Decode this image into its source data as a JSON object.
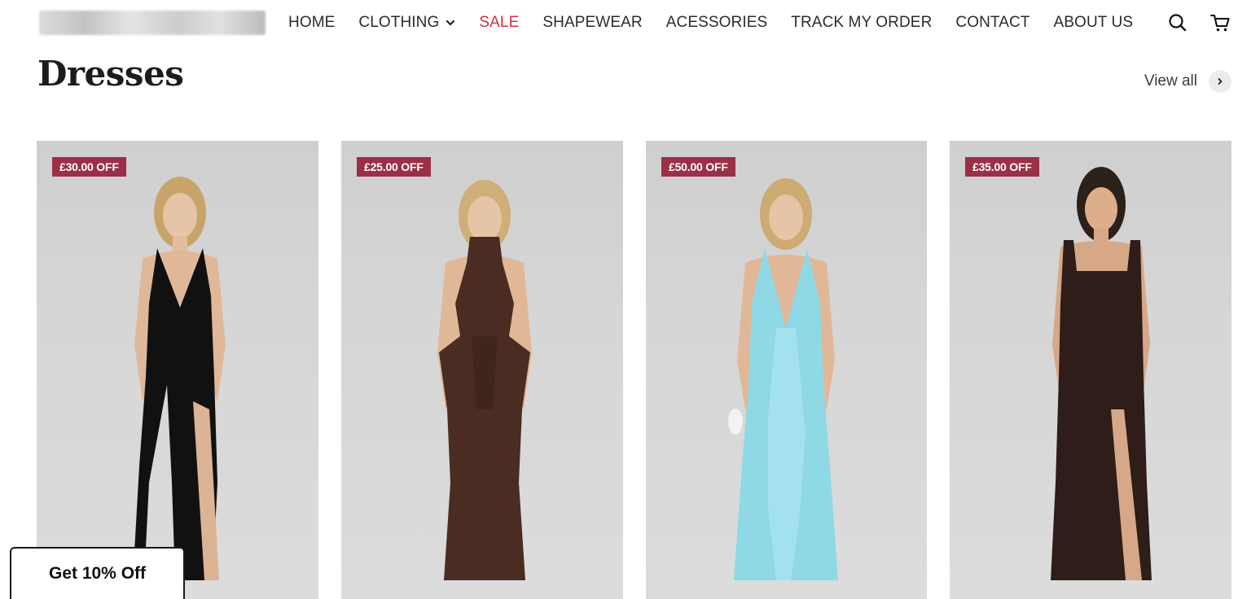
{
  "header": {
    "nav": [
      {
        "label": "HOME"
      },
      {
        "label": "CLOTHING"
      },
      {
        "label": "SALE"
      },
      {
        "label": "SHAPEWEAR"
      },
      {
        "label": "ACESSORIES"
      },
      {
        "label": "TRACK MY ORDER"
      },
      {
        "label": "CONTACT"
      },
      {
        "label": "ABOUT US"
      }
    ],
    "icons": [
      "search-icon",
      "cart-icon"
    ],
    "sale_color": "#d0323a"
  },
  "section": {
    "title": "Dresses",
    "view_all": "View all"
  },
  "products": [
    {
      "badge": "£30.00 OFF",
      "dress_color": "#111111"
    },
    {
      "badge": "£25.00 OFF",
      "dress_color": "#4a2c22"
    },
    {
      "badge": "£50.00 OFF",
      "dress_color": "#8fd8e6"
    },
    {
      "badge": "£35.00 OFF",
      "dress_color": "#2e1d18"
    }
  ],
  "badge_color": "#9c2f47",
  "promo": {
    "label": "Get 10% Off"
  }
}
